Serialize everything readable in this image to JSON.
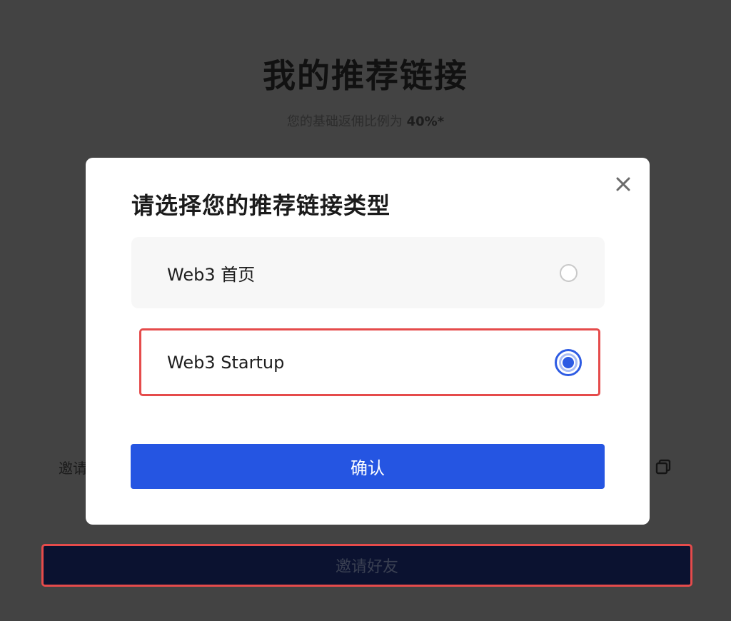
{
  "background": {
    "title": "我的推荐链接",
    "subtitle_prefix": "您的基础返佣比例为 ",
    "subtitle_rate": "40%*",
    "invite_label": "邀请",
    "invite_button_label": "邀请好友",
    "copy_icon": "copy-icon"
  },
  "modal": {
    "title": "请选择您的推荐链接类型",
    "close_icon": "close-icon",
    "options": [
      {
        "label": "Web3 首页",
        "selected": false
      },
      {
        "label": "Web3 Startup",
        "selected": true
      }
    ],
    "confirm_label": "确认"
  },
  "colors": {
    "accent": "#2555e2",
    "highlight": "#e54b4b",
    "overlay": "#434343"
  }
}
